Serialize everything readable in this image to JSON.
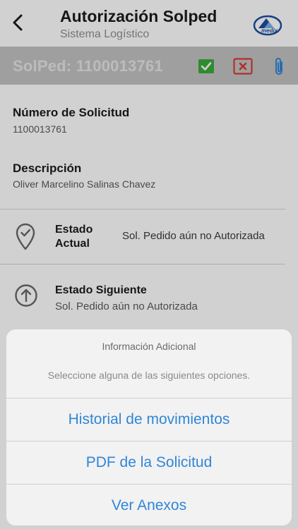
{
  "header": {
    "title": "Autorización Solped",
    "subtitle": "Sistema Logístico",
    "logo_text": "medix"
  },
  "solped_bar": {
    "id_text": "SolPed: 1100013761",
    "colors": {
      "approve": "#3aaa3a",
      "reject": "#d93a3a",
      "attach": "#2f86d8"
    }
  },
  "request": {
    "number_label": "Número de Solicitud",
    "number_value": "1100013761",
    "description_label": "Descripción",
    "description_value": "Oliver Marcelino Salinas Chavez"
  },
  "status": {
    "current_label_line1": "Estado",
    "current_label_line2": "Actual",
    "current_value": "Sol. Pedido aún no Autorizada",
    "next_label": "Estado Siguiente",
    "next_value": "Sol. Pedido aún no Autorizada"
  },
  "action_sheet": {
    "title": "Información Adicional",
    "message": "Seleccione alguna de las siguientes opciones.",
    "options": [
      "Historial de movimientos",
      "PDF de la Solicitud",
      "Ver Anexos"
    ]
  }
}
